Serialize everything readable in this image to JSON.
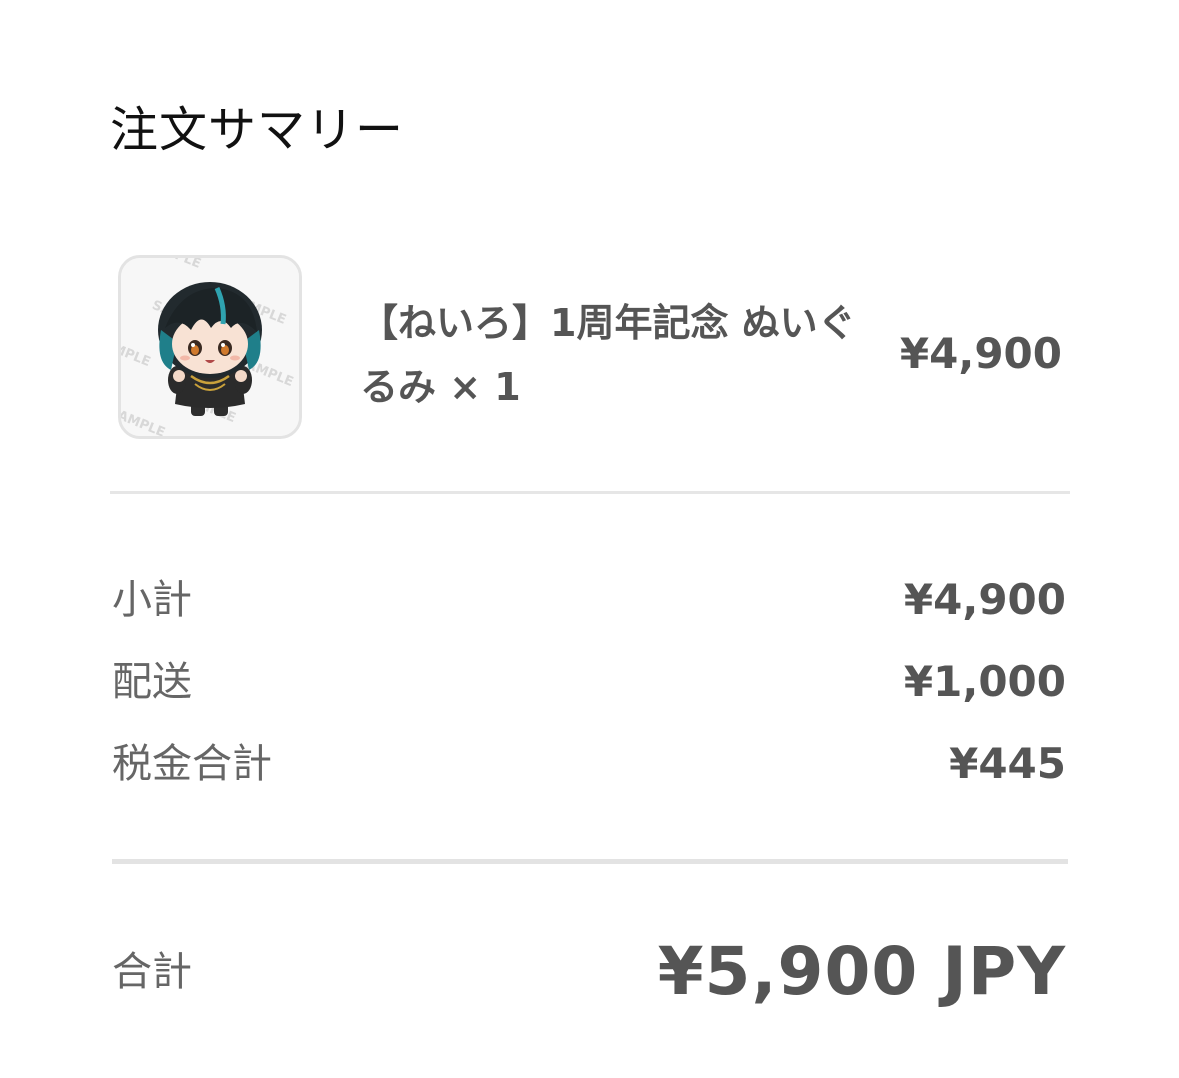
{
  "title": "注文サマリー",
  "item": {
    "name": "【ねいろ】1周年記念 ぬいぐるみ × 1",
    "price": "¥4,900",
    "image_watermark": "SAMPLE"
  },
  "summary": {
    "subtotal_label": "小計",
    "subtotal_value": "¥4,900",
    "shipping_label": "配送",
    "shipping_value": "¥1,000",
    "tax_label": "税金合計",
    "tax_value": "¥445"
  },
  "total": {
    "label": "合計",
    "value": "¥5,900 JPY"
  },
  "colors": {
    "primary_text": "#111111",
    "secondary_text": "#555555",
    "divider": "#e6e6e6"
  }
}
